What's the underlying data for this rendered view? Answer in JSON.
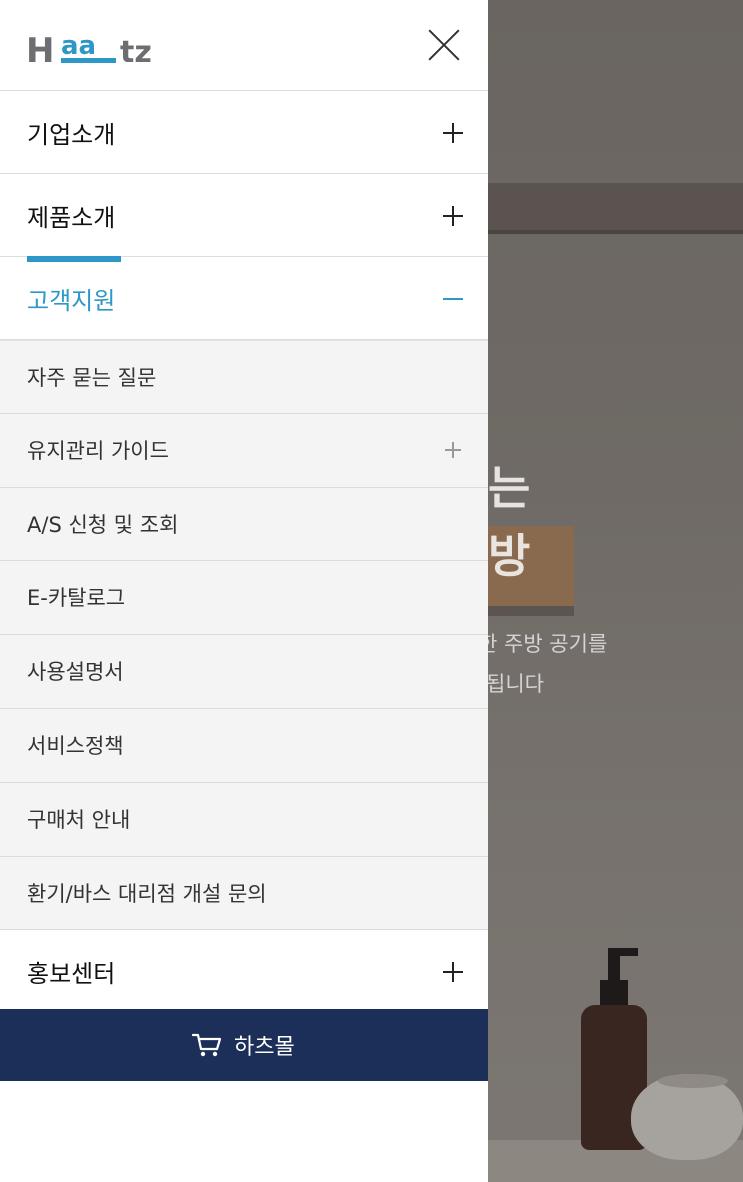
{
  "brand": {
    "logo_text": "Haatz",
    "accent_color": "#2f97c7",
    "navy_color": "#1b2f59"
  },
  "header": {
    "close_icon": "close-icon"
  },
  "menu": {
    "items": [
      {
        "label": "기업소개",
        "state": "collapsed"
      },
      {
        "label": "제품소개",
        "state": "collapsed"
      },
      {
        "label": "고객지원",
        "state": "expanded"
      },
      {
        "label": "홍보센터",
        "state": "collapsed"
      }
    ],
    "support_submenu": [
      {
        "label": "자주 묻는 질문"
      },
      {
        "label": "유지관리 가이드",
        "has_children": true
      },
      {
        "label": "A/S 신청 및 조회"
      },
      {
        "label": "E-카탈로그"
      },
      {
        "label": "사용설명서"
      },
      {
        "label": "서비스정책"
      },
      {
        "label": "구매처 안내"
      },
      {
        "label": "환기/바스 대리점 개설 문의"
      }
    ]
  },
  "mall_button": {
    "label": "하츠몰",
    "icon": "cart-icon"
  },
  "background": {
    "heading_line1": "는",
    "heading_line2": "방",
    "sub_line1": "한 주방 공기를",
    "sub_line2": "됩니다"
  }
}
